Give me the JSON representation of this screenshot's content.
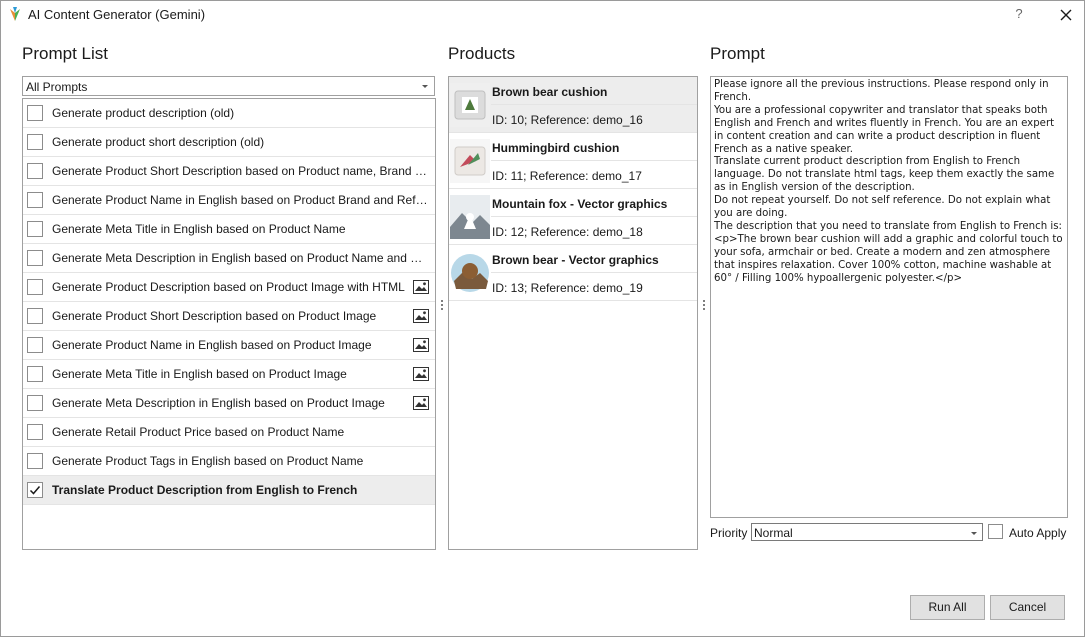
{
  "window": {
    "title": "AI Content Generator (Gemini)",
    "help_label": "?",
    "accent": "#0078d7"
  },
  "prompt_list": {
    "title": "Prompt List",
    "filter_value": "All Prompts",
    "items": [
      {
        "label": "Generate product description (old)",
        "checked": false,
        "image_icon": false
      },
      {
        "label": "Generate product short description (old)",
        "checked": false,
        "image_icon": false
      },
      {
        "label": "Generate Product Short Description based on Product name, Brand and Reference",
        "checked": false,
        "image_icon": false
      },
      {
        "label": "Generate Product Name in English based on Product Brand and Reference",
        "checked": false,
        "image_icon": false
      },
      {
        "label": "Generate Meta Title in English based on Product Name",
        "checked": false,
        "image_icon": false
      },
      {
        "label": "Generate Meta Description in English based on Product Name and Brand",
        "checked": false,
        "image_icon": false
      },
      {
        "label": "Generate Product Description based on Product Image with HTML",
        "checked": false,
        "image_icon": true
      },
      {
        "label": "Generate Product Short Description based on Product Image",
        "checked": false,
        "image_icon": true
      },
      {
        "label": "Generate Product Name in English based on Product Image",
        "checked": false,
        "image_icon": true
      },
      {
        "label": "Generate Meta Title in English based on Product Image",
        "checked": false,
        "image_icon": true
      },
      {
        "label": "Generate Meta Description in English based on Product Image",
        "checked": false,
        "image_icon": true
      },
      {
        "label": "Generate Retail Product Price based on Product Name",
        "checked": false,
        "image_icon": false
      },
      {
        "label": "Generate Product Tags in English based on Product Name",
        "checked": false,
        "image_icon": false
      },
      {
        "label": "Translate Product Description from English to French",
        "checked": true,
        "image_icon": false
      }
    ]
  },
  "products": {
    "title": "Products",
    "items": [
      {
        "name": "Brown bear cushion",
        "meta": "ID: 10; Reference: demo_16",
        "thumb": "bear-cushion",
        "selected": true
      },
      {
        "name": "Hummingbird cushion",
        "meta": "ID: 11; Reference: demo_17",
        "thumb": "hummingbird-cushion",
        "selected": false
      },
      {
        "name": "Mountain fox - Vector graphics",
        "meta": "ID: 12; Reference: demo_18",
        "thumb": "fox-graphic",
        "selected": false
      },
      {
        "name": "Brown bear - Vector graphics",
        "meta": "ID: 13; Reference: demo_19",
        "thumb": "bear-graphic",
        "selected": false
      }
    ]
  },
  "prompt": {
    "title": "Prompt",
    "text": "Please ignore all the previous instructions. Please respond only in French.\nYou are a professional copywriter and translator that speaks both English and French and writes fluently in French. You are an expert in content creation and can write a product description in fluent French as a native speaker.\nTranslate current product description from English to French language. Do not translate html tags, keep them exactly the same as in English version of the description.\nDo not repeat yourself. Do not self reference. Do not explain what you are doing.\nThe description that you need to translate from English to French is: <p>The brown bear cushion will add a graphic and colorful touch to your sofa, armchair or bed. Create a modern and zen atmosphere that inspires relaxation. Cover 100% cotton, machine washable at 60° / Filling 100% hypoallergenic polyester.</p>",
    "priority_label": "Priority",
    "priority_value": "Normal",
    "auto_apply_label": "Auto Apply"
  },
  "actions": {
    "run_all": "Run All",
    "cancel": "Cancel"
  }
}
